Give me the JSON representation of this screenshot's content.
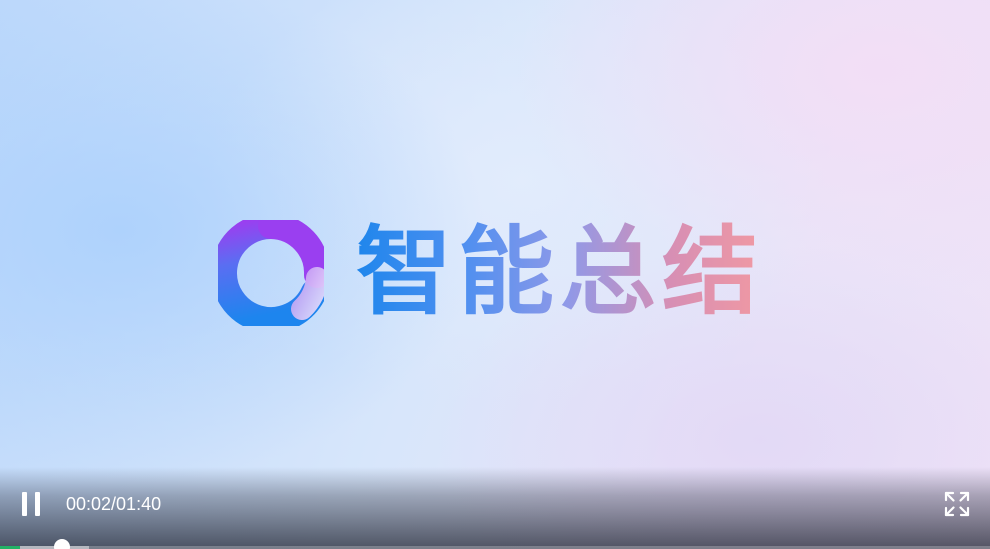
{
  "video": {
    "title_text": "智能总结",
    "logo_icon": "ring-logo-icon"
  },
  "controls": {
    "play_state_icon": "pause-icon",
    "current_time": "00:02",
    "duration": "01:40",
    "time_display": "00:02/01:40",
    "fullscreen_icon": "fullscreen-icon",
    "progress_fraction": 0.02,
    "buffered_fraction": 0.09,
    "progress_color": "#22b266"
  }
}
